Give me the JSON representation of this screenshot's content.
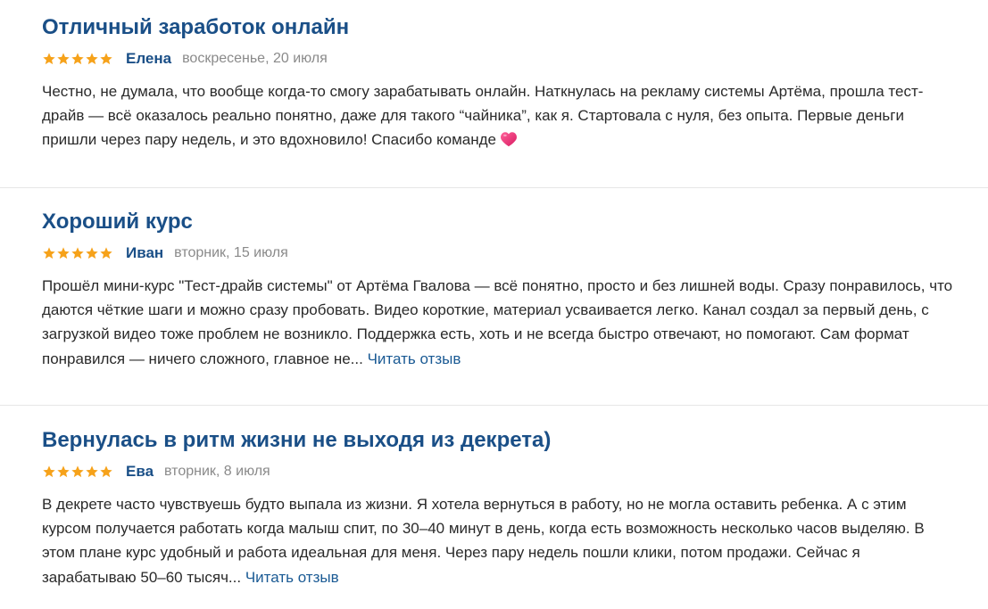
{
  "reviews": [
    {
      "title": "Отличный заработок онлайн",
      "rating": 5,
      "author": "Елена",
      "date": "воскресенье, 20 июля",
      "text": "Честно, не думала, что вообще когда-то смогу зарабатывать онлайн. Наткнулась на рекламу системы Артёма, прошла тест-драйв — всё оказалось реально понятно, даже для такого “чайника”, как я. Стартовала с нуля, без опыта. Первые деньги пришли через пару недель, и это вдохновило! Спасибо команде",
      "emoji": "heart-icon"
    },
    {
      "title": "Хороший курс",
      "rating": 5,
      "author": "Иван",
      "date": "вторник, 15 июля",
      "text": "Прошёл мини-курс \"Тест-драйв системы\" от Артёма Гвалова — всё понятно, просто и без лишней воды. Сразу понравилось, что даются чёткие шаги и можно сразу пробовать. Видео короткие, материал усваивается легко. Канал создал за первый день, с загрузкой видео тоже проблем не возникло. Поддержка есть, хоть и не всегда быстро отвечают, но помогают. Сам формат понравился — ничего сложного, главное не...",
      "read_more": "Читать отзыв"
    },
    {
      "title": "Вернулась в ритм жизни не выходя из декрета)",
      "rating": 5,
      "author": "Ева",
      "date": "вторник, 8 июля",
      "text": "В декрете часто чувствуешь будто выпала из жизни. Я хотела вернуться в работу, но не могла оставить ребенка. А с этим курсом получается работать когда малыш спит, по 30–40 минут в день, когда есть возможность несколько часов выделяю. В этом плане курс удобный и работа идеальная для меня. Через пару недель пошли клики, потом продажи. Сейчас я зарабатываю 50–60 тысяч...",
      "read_more": "Читать отзыв"
    }
  ],
  "colors": {
    "title": "#1a4f87",
    "star": "#f6a21a",
    "date": "#8a8a8a",
    "link": "#1a5a94"
  }
}
